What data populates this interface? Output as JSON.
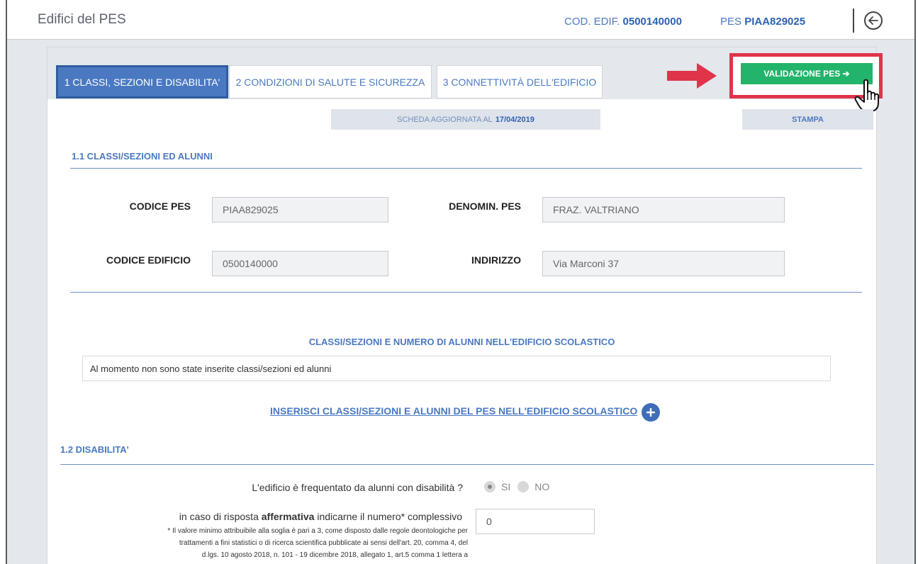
{
  "header": {
    "title": "Edifici del PES",
    "cod_label": "COD. EDIF.",
    "cod_value": "0500140000",
    "pes_label": "PES",
    "pes_value": "PIAA829025"
  },
  "tabs": [
    {
      "label": "1 CLASSI, SEZIONI E DISABILITA'",
      "active": true
    },
    {
      "label": "2 CONDIZIONI DI SALUTE E SICUREZZA",
      "active": false
    },
    {
      "label": "3 CONNETTIVITÀ DELL'EDIFICIO",
      "active": false
    }
  ],
  "actions": {
    "validate_label": "VALIDAZIONE PES ➔",
    "print_label": "STAMPA",
    "updated_prefix": "SCHEDA AGGIORNATA AL",
    "updated_date": "17/04/2019"
  },
  "section1": {
    "title": "1.1 CLASSI/SEZIONI ED ALUNNI",
    "fields": {
      "codice_pes_label": "CODICE PES",
      "codice_pes_value": "PIAA829025",
      "denomin_label": "DENOMIN. PES",
      "denomin_value": "FRAZ. VALTRIANO",
      "codice_edificio_label": "CODICE EDIFICIO",
      "codice_edificio_value": "0500140000",
      "indirizzo_label": "INDIRIZZO",
      "indirizzo_value": "Via Marconi 37"
    },
    "classes_title": "CLASSI/SEZIONI E NUMERO DI ALUNNI NELL'EDIFICIO SCOLASTICO",
    "empty_message": "Al momento non sono state inserite classi/sezioni ed alunni",
    "insert_link": "INSERISCI CLASSI/SEZIONI E ALUNNI DEL PES NELL'EDIFICIO SCOLASTICO"
  },
  "section2": {
    "title": "1.2 DISABILITA'",
    "question": "L'edificio è frequentato da alunni con disabilità ?",
    "radio_yes": "SI",
    "radio_no": "NO",
    "selected": "SI",
    "count_prefix": "in caso di risposta",
    "count_bold": "affermativa",
    "count_suffix": "indicarne il numero* complessivo",
    "count_value": "0",
    "note_line1": "* Il valore minimo attribuibile alla soglia è pari a 3, come disposto dalle regole deontologiche per",
    "note_line2": "trattamenti a fini statistici o di ricerca scientifica pubblicate ai sensi dell'art. 20, comma 4, del",
    "note_line3": "d.lgs. 10 agosto 2018, n. 101 - 19 dicembre 2018, allegato 1, art.5 comma 1 lettera a"
  },
  "colors": {
    "accent": "#4a79c2",
    "success": "#22b46a",
    "highlight": "#e0344a"
  }
}
